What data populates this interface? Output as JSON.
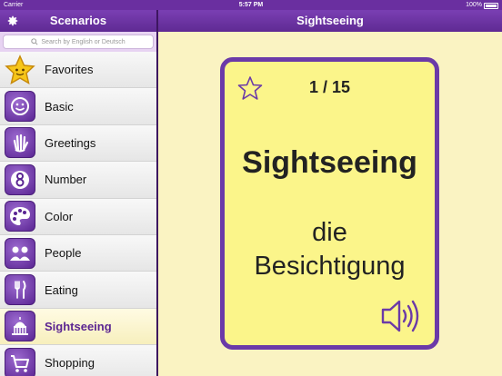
{
  "status": {
    "carrier": "Carrier",
    "time": "5:57 PM",
    "battery": "100%"
  },
  "sidebar": {
    "title": "Scenarios",
    "search_placeholder": "Search by English or Deutsch",
    "items": [
      {
        "label": "Favorites",
        "icon": "favorites-star-icon",
        "selected": false
      },
      {
        "label": "Basic",
        "icon": "smiley-face-icon",
        "selected": false
      },
      {
        "label": "Greetings",
        "icon": "waving-hand-icon",
        "selected": false
      },
      {
        "label": "Number",
        "icon": "number-eight-icon",
        "selected": false
      },
      {
        "label": "Color",
        "icon": "paint-palette-icon",
        "selected": false
      },
      {
        "label": "People",
        "icon": "people-group-icon",
        "selected": false
      },
      {
        "label": "Eating",
        "icon": "fork-knife-icon",
        "selected": true
      },
      {
        "label": "Sightseeing",
        "icon": "capitol-building-icon",
        "selected": true
      },
      {
        "label": "Shopping",
        "icon": "shopping-cart-icon",
        "selected": false
      }
    ]
  },
  "detail": {
    "title": "Sightseeing",
    "card": {
      "counter": "1 / 15",
      "english": "Sightseeing",
      "german_line1": "die",
      "german_line2": "Besichtigung"
    }
  },
  "colors": {
    "accent": "#6b3aa8",
    "card_bg": "#fbf58a",
    "detail_bg": "#faf3c2"
  }
}
